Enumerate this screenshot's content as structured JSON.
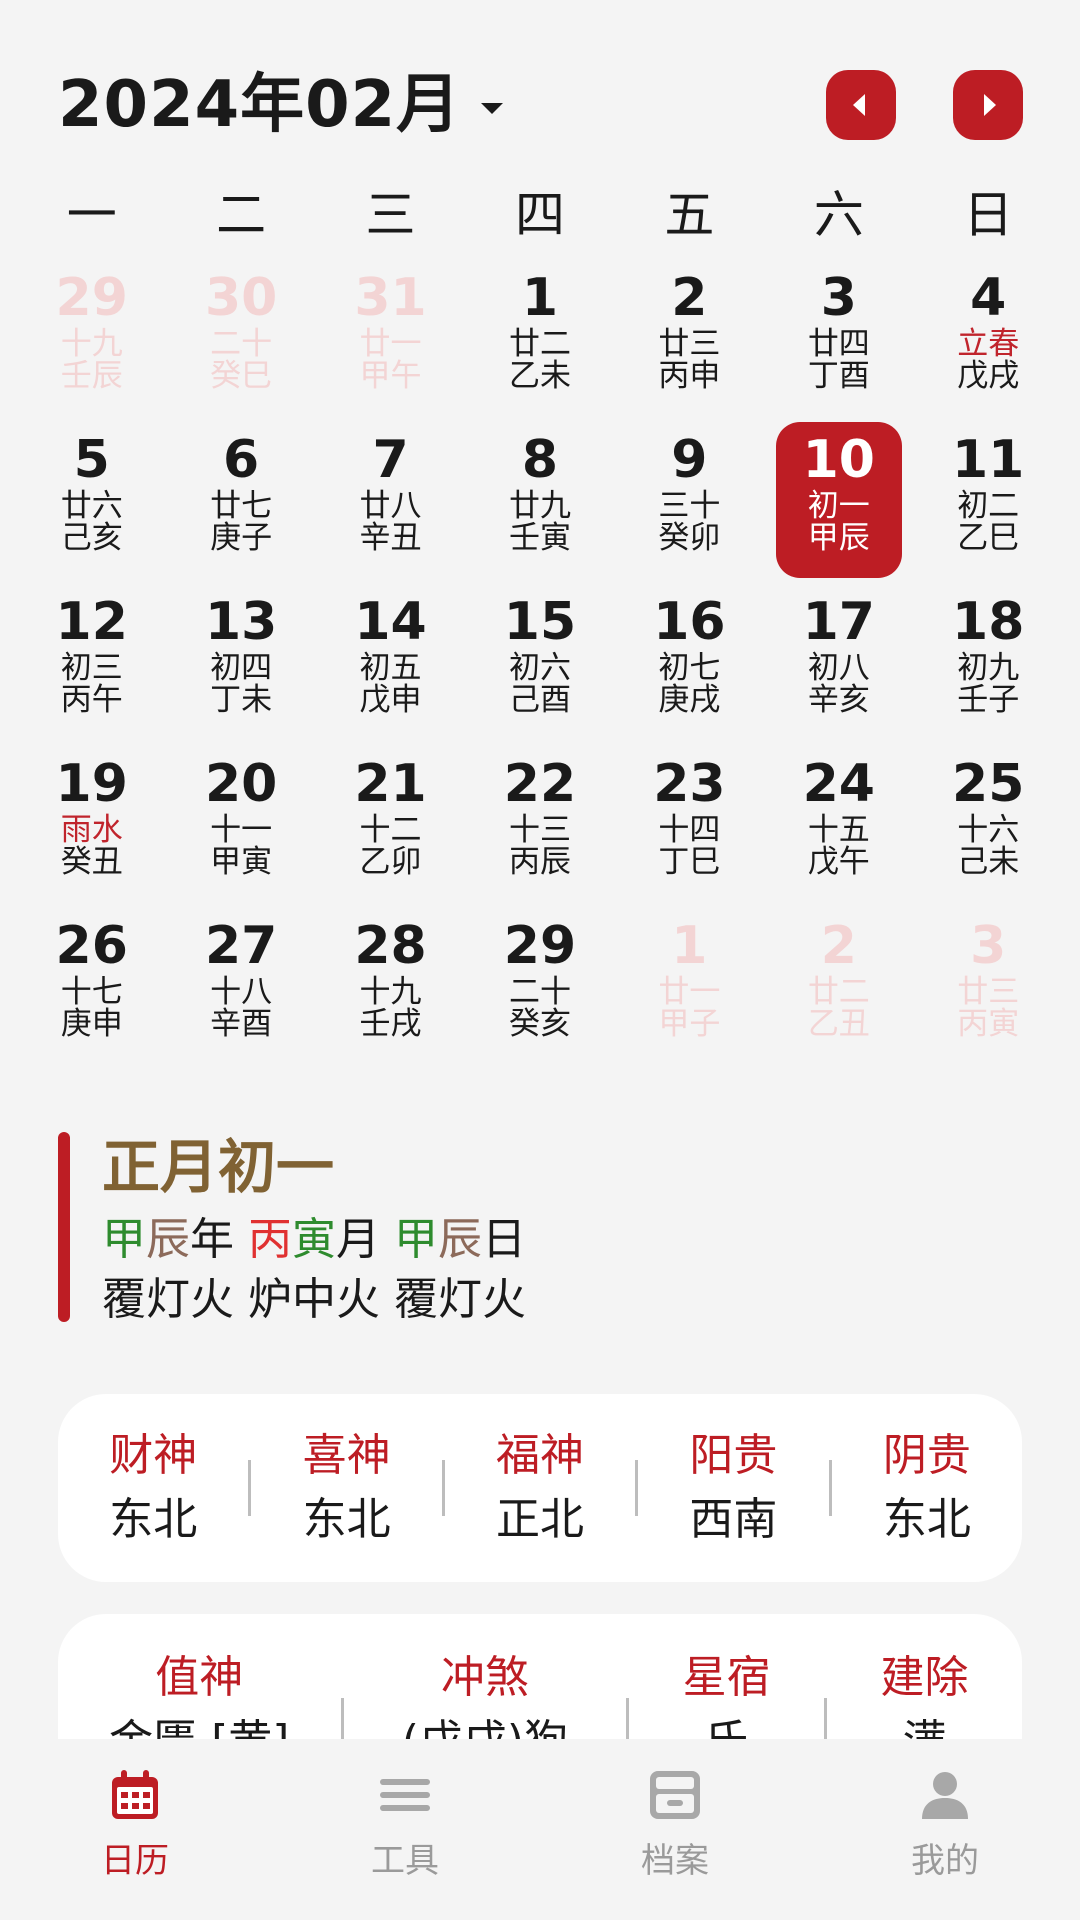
{
  "header": {
    "month_title": "2024年02月"
  },
  "weekdays": [
    "一",
    "二",
    "三",
    "四",
    "五",
    "六",
    "日"
  ],
  "calendar": {
    "rows": [
      [
        {
          "day": "29",
          "lunar": "十九",
          "ganzhi": "壬辰",
          "other": true
        },
        {
          "day": "30",
          "lunar": "二十",
          "ganzhi": "癸巳",
          "other": true
        },
        {
          "day": "31",
          "lunar": "廿一",
          "ganzhi": "甲午",
          "other": true
        },
        {
          "day": "1",
          "lunar": "廿二",
          "ganzhi": "乙未"
        },
        {
          "day": "2",
          "lunar": "廿三",
          "ganzhi": "丙申"
        },
        {
          "day": "3",
          "lunar": "廿四",
          "ganzhi": "丁酉"
        },
        {
          "day": "4",
          "lunar": "立春",
          "ganzhi": "戊戌",
          "term": true
        }
      ],
      [
        {
          "day": "5",
          "lunar": "廿六",
          "ganzhi": "己亥"
        },
        {
          "day": "6",
          "lunar": "廿七",
          "ganzhi": "庚子"
        },
        {
          "day": "7",
          "lunar": "廿八",
          "ganzhi": "辛丑"
        },
        {
          "day": "8",
          "lunar": "廿九",
          "ganzhi": "壬寅"
        },
        {
          "day": "9",
          "lunar": "三十",
          "ganzhi": "癸卯"
        },
        {
          "day": "10",
          "lunar": "初一",
          "ganzhi": "甲辰",
          "selected": true
        },
        {
          "day": "11",
          "lunar": "初二",
          "ganzhi": "乙巳"
        }
      ],
      [
        {
          "day": "12",
          "lunar": "初三",
          "ganzhi": "丙午"
        },
        {
          "day": "13",
          "lunar": "初四",
          "ganzhi": "丁未"
        },
        {
          "day": "14",
          "lunar": "初五",
          "ganzhi": "戊申"
        },
        {
          "day": "15",
          "lunar": "初六",
          "ganzhi": "己酉"
        },
        {
          "day": "16",
          "lunar": "初七",
          "ganzhi": "庚戌"
        },
        {
          "day": "17",
          "lunar": "初八",
          "ganzhi": "辛亥"
        },
        {
          "day": "18",
          "lunar": "初九",
          "ganzhi": "壬子"
        }
      ],
      [
        {
          "day": "19",
          "lunar": "雨水",
          "ganzhi": "癸丑",
          "term": true
        },
        {
          "day": "20",
          "lunar": "十一",
          "ganzhi": "甲寅"
        },
        {
          "day": "21",
          "lunar": "十二",
          "ganzhi": "乙卯"
        },
        {
          "day": "22",
          "lunar": "十三",
          "ganzhi": "丙辰"
        },
        {
          "day": "23",
          "lunar": "十四",
          "ganzhi": "丁巳"
        },
        {
          "day": "24",
          "lunar": "十五",
          "ganzhi": "戊午"
        },
        {
          "day": "25",
          "lunar": "十六",
          "ganzhi": "己未"
        }
      ],
      [
        {
          "day": "26",
          "lunar": "十七",
          "ganzhi": "庚申"
        },
        {
          "day": "27",
          "lunar": "十八",
          "ganzhi": "辛酉"
        },
        {
          "day": "28",
          "lunar": "十九",
          "ganzhi": "壬戌"
        },
        {
          "day": "29",
          "lunar": "二十",
          "ganzhi": "癸亥"
        },
        {
          "day": "1",
          "lunar": "廿一",
          "ganzhi": "甲子",
          "other": true
        },
        {
          "day": "2",
          "lunar": "廿二",
          "ganzhi": "乙丑",
          "other": true
        },
        {
          "day": "3",
          "lunar": "廿三",
          "ganzhi": "丙寅",
          "other": true
        }
      ]
    ]
  },
  "info": {
    "lunar_date": "正月初一",
    "year_gan": "甲",
    "year_zhi": "辰",
    "year_suffix": "年",
    "month_gan": "丙",
    "month_zhi": "寅",
    "month_suffix": "月",
    "day_gan": "甲",
    "day_zhi": "辰",
    "day_suffix": "日",
    "nayin": "覆灯火 炉中火 覆灯火"
  },
  "gods": [
    {
      "key": "财神",
      "value": "东北"
    },
    {
      "key": "喜神",
      "value": "东北"
    },
    {
      "key": "福神",
      "value": "正北"
    },
    {
      "key": "阳贵",
      "value": "西南"
    },
    {
      "key": "阴贵",
      "value": "东北"
    }
  ],
  "details": [
    {
      "key": "值神",
      "value": "金匮 [黄]"
    },
    {
      "key": "冲煞",
      "value": "(戊戌)狗"
    },
    {
      "key": "星宿",
      "value": "氐"
    },
    {
      "key": "建除",
      "value": "满"
    }
  ],
  "tabs": [
    {
      "label": "日历",
      "icon": "calendar-icon",
      "active": true
    },
    {
      "label": "工具",
      "icon": "menu-icon"
    },
    {
      "label": "档案",
      "icon": "archive-icon"
    },
    {
      "label": "我的",
      "icon": "profile-icon"
    }
  ],
  "colors": {
    "accent": "#bd1d24",
    "lunar_title": "#806233",
    "gan_green": "#2e8b2e",
    "zhi_brown": "#8c6a5a",
    "gan_red": "#e03131"
  }
}
